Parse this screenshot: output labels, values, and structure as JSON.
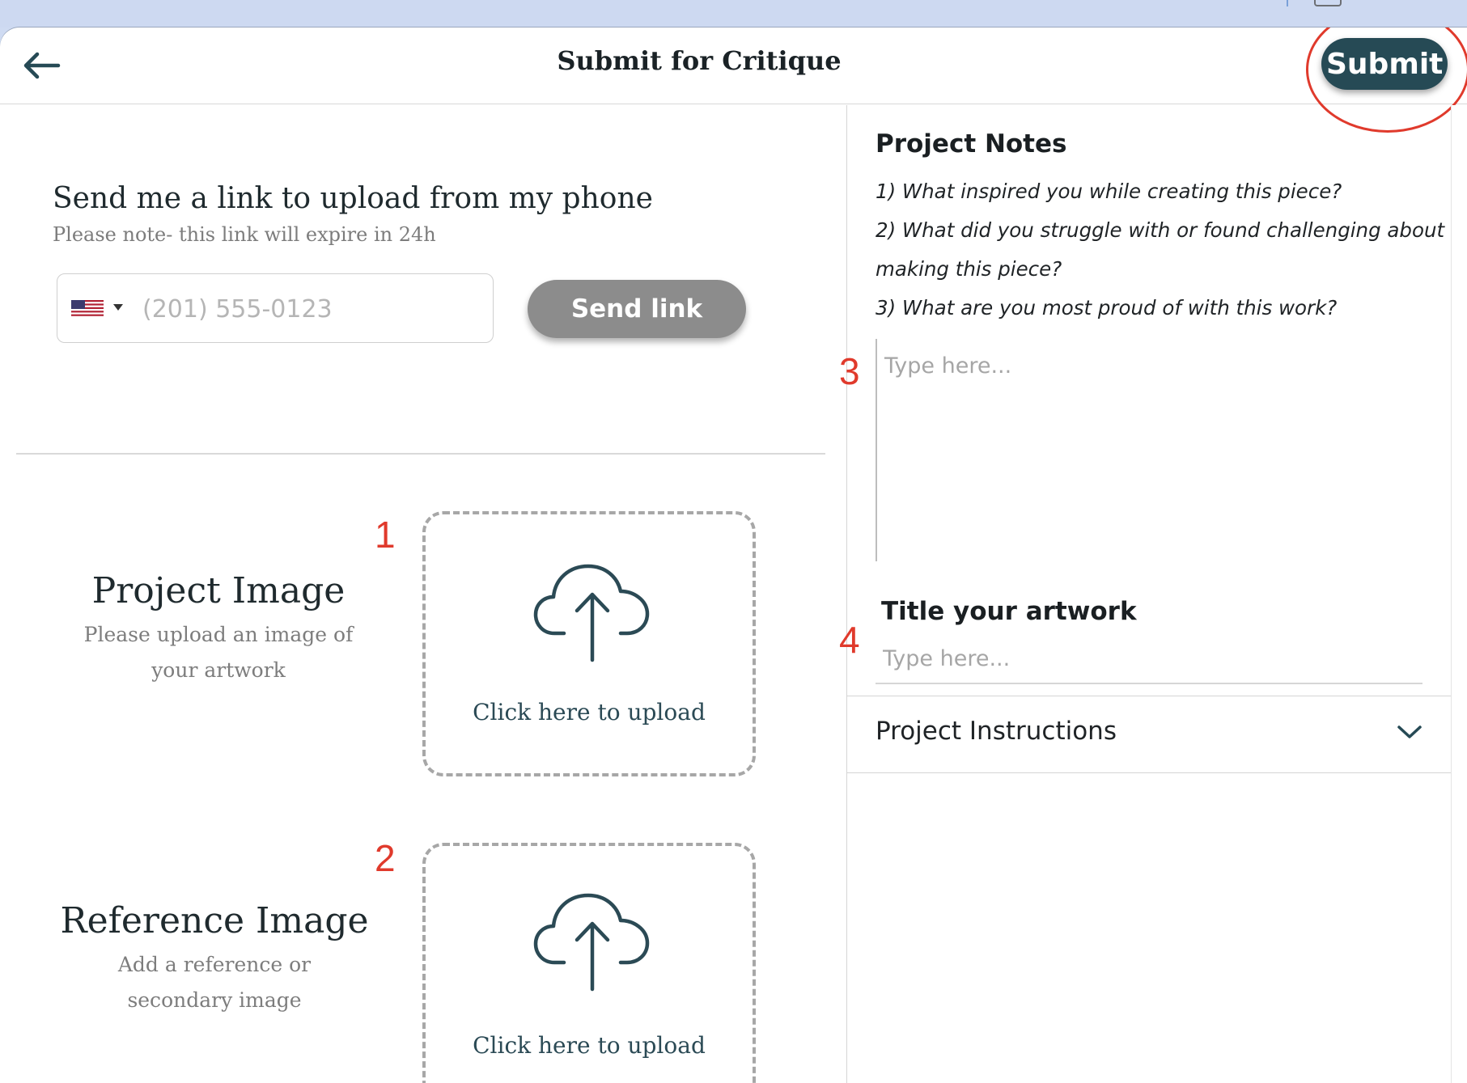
{
  "header": {
    "title": "Submit for Critique",
    "submit_label": "Submit",
    "icons": {
      "back": "arrow-left-icon"
    }
  },
  "phone_upload": {
    "title": "Send me a link to upload from my phone",
    "note": "Please note- this link will expire in 24h",
    "country_flag": "us-flag-icon",
    "phone_placeholder": "(201) 555-0123",
    "send_label": "Send link"
  },
  "uploads": [
    {
      "marker": "1",
      "title": "Project Image",
      "subtitle": "Please upload an image of your artwork",
      "drop_text": "Click here to upload",
      "icon": "cloud-upload-icon"
    },
    {
      "marker": "2",
      "title": "Reference Image",
      "subtitle": "Add a reference or secondary image",
      "drop_text": "Click here to upload",
      "icon": "cloud-upload-icon"
    }
  ],
  "notes": {
    "title": "Project Notes",
    "prompts": [
      "1) What inspired you while creating this piece?",
      "2) What did you struggle with or found challenging about",
      "making this piece?",
      "3) What are you most proud of with this work?"
    ],
    "marker": "3",
    "placeholder": "Type here..."
  },
  "artwork_title": {
    "label": "Title your artwork",
    "marker": "4",
    "placeholder": "Type here..."
  },
  "instructions": {
    "label": "Project Instructions",
    "icon": "chevron-down-icon"
  },
  "colors": {
    "accent": "#264a55",
    "annotation": "#e03a2c",
    "send_button": "#8c8c8c"
  }
}
